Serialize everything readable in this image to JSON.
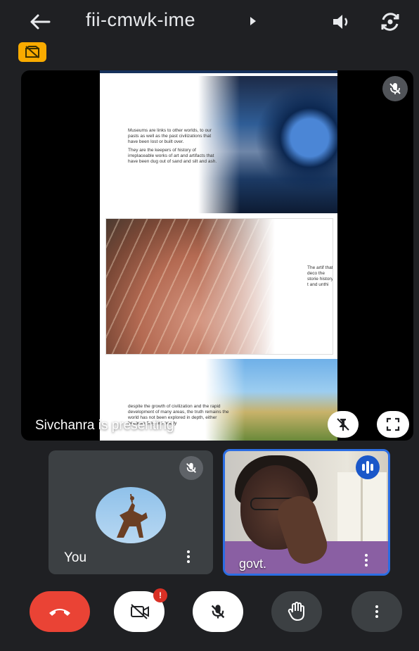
{
  "header": {
    "meeting_code": "fii-cmwk-ime",
    "back_icon": "arrow-left-icon",
    "speaker_icon": "volume-icon",
    "switch_camera_icon": "switch-camera-icon",
    "badge_icon": "no-recording-icon"
  },
  "stage": {
    "presenting_text": "Sivchanra is presenting",
    "slide": {
      "panel1_bullets": [
        "Museums are links to other worlds, to our pasts as well as the past civilizations that have been lost or built over.",
        "They are the keepers of history of irreplaceable works of art and artifacts that have been dug out of sand and silt and ash."
      ],
      "panel2_bullets": [
        "The artif that deco the storie history, t and unthi"
      ],
      "panel3_bullets": [
        "despite the growth of civilization and the rapid development of many areas, the truth remains the world has not been explored in depth, either because they are nearly"
      ]
    },
    "pin_icon": "unpin-icon",
    "fullscreen_icon": "fullscreen-icon",
    "muted_icon": "mic-off-icon"
  },
  "tiles": {
    "you": {
      "label": "You",
      "muted_icon": "mic-off-icon",
      "more_icon": "more-vert-icon"
    },
    "govt": {
      "label": "govt.",
      "speaking_icon": "audio-level-icon",
      "more_icon": "more-vert-icon"
    }
  },
  "controls": {
    "end_call": "call-end-icon",
    "camera": "videocam-off-icon",
    "camera_notification": "!",
    "mic": "mic-off-icon",
    "raise_hand": "hand-icon",
    "more": "more-vert-icon"
  },
  "colors": {
    "background": "#1f2023",
    "end_call": "#ea4335",
    "badge": "#f9ab00",
    "active_speaker_border": "#2b6de3",
    "notification": "#d93025"
  }
}
